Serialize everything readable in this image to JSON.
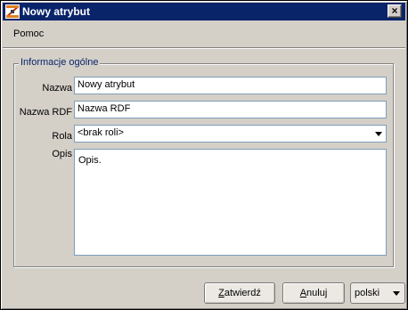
{
  "window": {
    "title": "Nowy atrybut",
    "close_glyph": "×"
  },
  "menu": {
    "items": [
      "Pomoc"
    ]
  },
  "group": {
    "legend": "Informacje ogólne"
  },
  "form": {
    "name_label": "Nazwa",
    "name_value": "Nowy atrybut",
    "rdf_label": "Nazwa RDF",
    "rdf_value": "Nazwa RDF",
    "role_label": "Rola",
    "role_value": "<brak roli>",
    "desc_label": "Opis",
    "desc_value": "Opis."
  },
  "buttons": {
    "confirm_first": "Z",
    "confirm_rest": "atwierdź",
    "cancel_first": "A",
    "cancel_rest": "nuluj"
  },
  "language": {
    "selected": "polski"
  },
  "icons": {
    "app": "app-logo-icon",
    "close": "close-icon",
    "dropdown": "chevron-down-icon"
  },
  "colors": {
    "titlebar": "#0a246a",
    "window_bg": "#d4d0c8",
    "legend_text": "#0a246a"
  }
}
